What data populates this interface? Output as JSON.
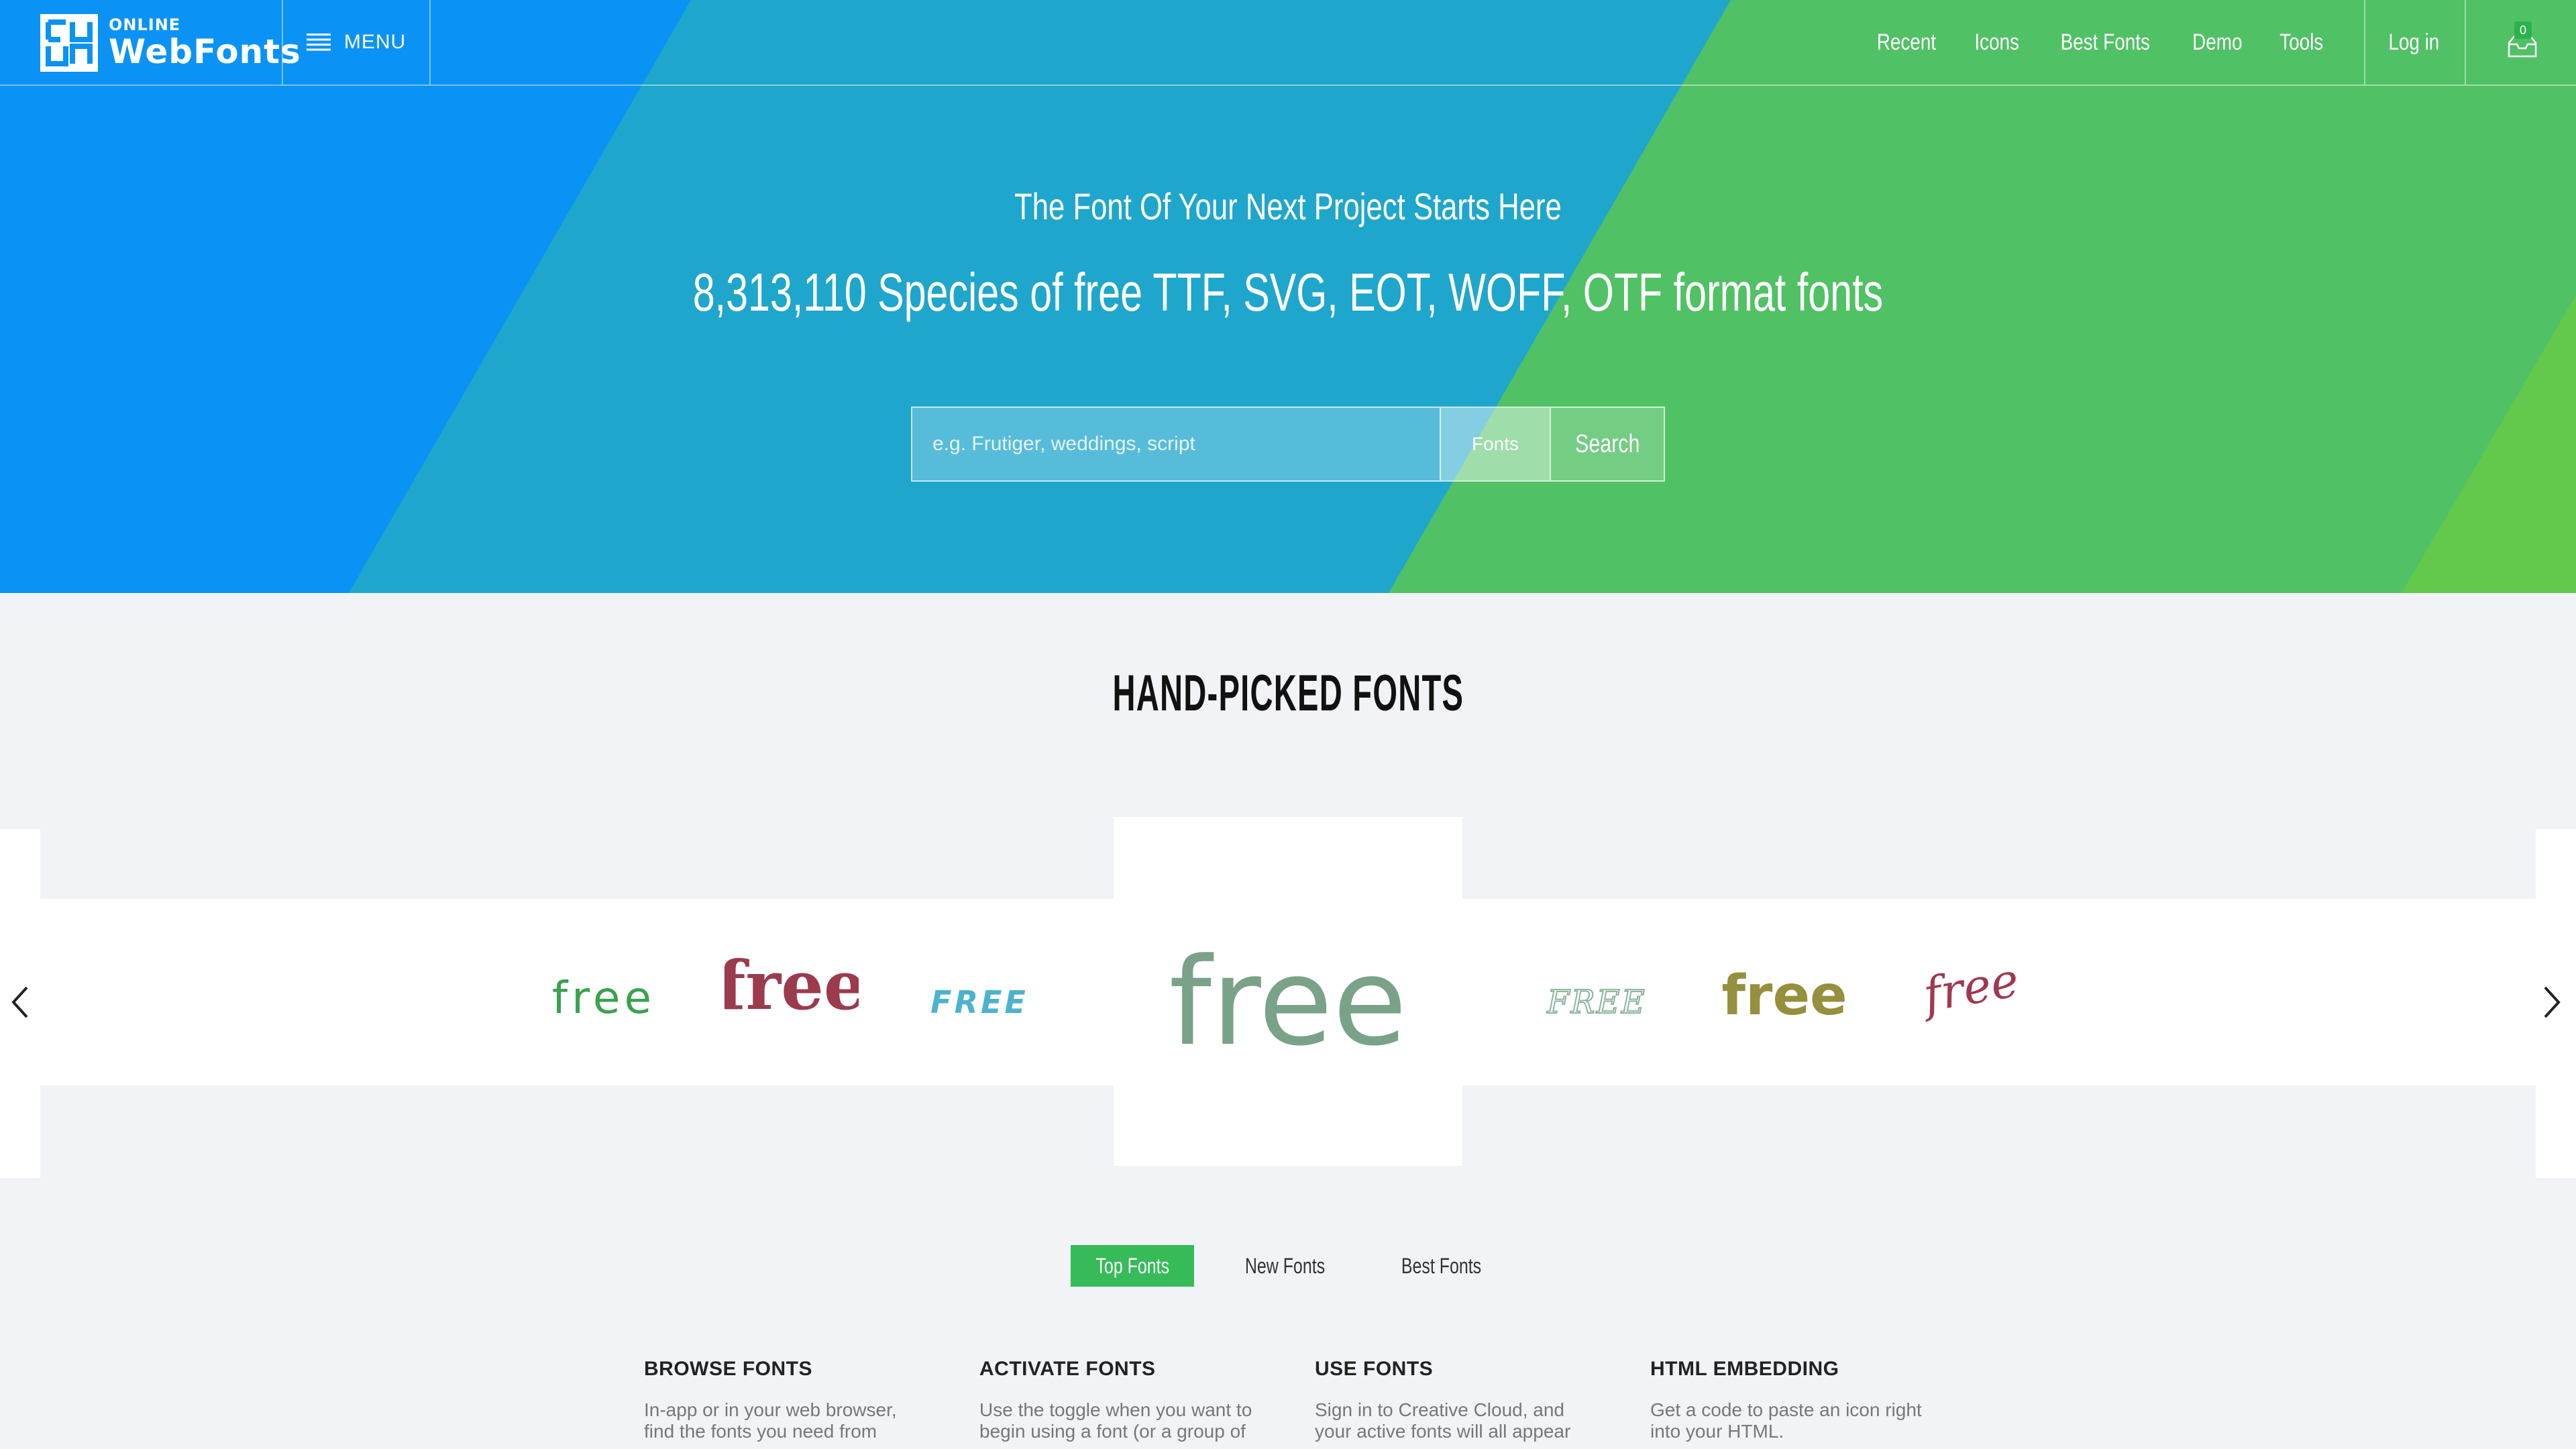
{
  "header": {
    "logo": {
      "small": "ONLINE",
      "big": "WebFonts"
    },
    "menu_label": "MENU",
    "nav": [
      "Recent",
      "Icons",
      "Best Fonts",
      "Demo",
      "Tools"
    ],
    "login_label": "Log in",
    "cart_count": "0"
  },
  "hero": {
    "tagline": "The Font Of Your Next Project Starts Here",
    "headline": "8,313,110 Species of free TTF, SVG, EOT, WOFF, OTF format fonts",
    "search": {
      "placeholder": "e.g. Frutiger, weddings, script",
      "type_label": "Fonts",
      "button_label": "Search"
    },
    "colors": {
      "blue": "#0a93f5",
      "teal": "#1fa6cc",
      "green": "#51c165",
      "lime": "#63c94d"
    }
  },
  "handpicked": {
    "title": "HAND-PICKED FONTS",
    "samples": [
      {
        "text": "free",
        "color": "#3aa24e"
      },
      {
        "text": "free",
        "color": "#9c3a4e"
      },
      {
        "text": "FREE",
        "color": "#4cb3cf"
      },
      {
        "text": "free",
        "color": "#7aa289"
      },
      {
        "text": "FREE",
        "color": "#8ab59c"
      },
      {
        "text": "free",
        "color": "#96903e"
      },
      {
        "text": "free",
        "color": "#a0384f"
      }
    ]
  },
  "tabs": {
    "items": [
      "Top Fonts",
      "New Fonts",
      "Best Fonts"
    ],
    "active": "Top Fonts",
    "active_color": "#36bb58"
  },
  "features": [
    {
      "title": "BROWSE FONTS",
      "text": "In-app or in your web browser, find the fonts you need from"
    },
    {
      "title": "ACTIVATE FONTS",
      "text": "Use the toggle when you want to begin using a font (or a group of"
    },
    {
      "title": "USE FONTS",
      "text": "Sign in to Creative Cloud, and your active fonts will all appear"
    },
    {
      "title": "HTML EMBEDDING",
      "text": "Get a code to paste an icon right into your HTML."
    }
  ]
}
